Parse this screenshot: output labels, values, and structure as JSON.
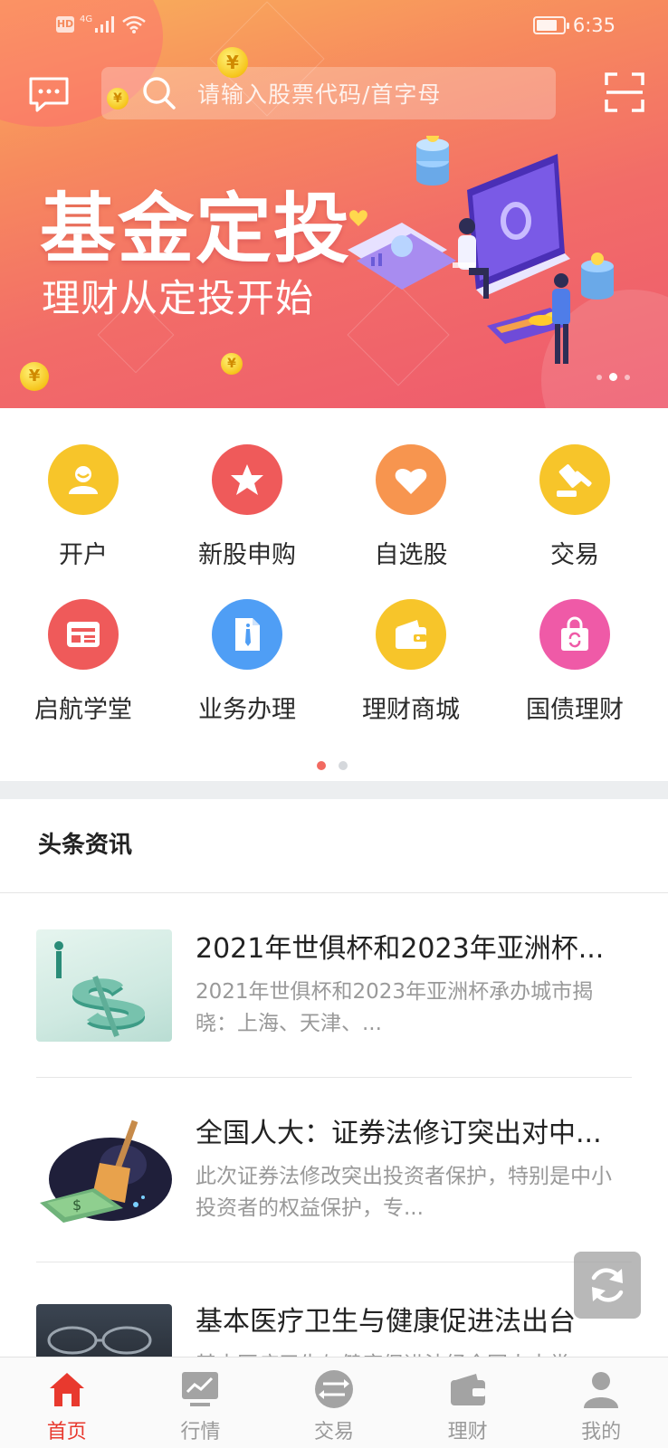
{
  "status_bar": {
    "hd": "HD",
    "network": "4G",
    "time": "6:35",
    "battery_level": 0.8
  },
  "search": {
    "placeholder": "请输入股票代码/首字母"
  },
  "banner": {
    "title": "基金定投",
    "subtitle": "理财从定投开始",
    "coin_glyph": "¥",
    "slides_count": 3,
    "active_slide": 2
  },
  "quick_actions": {
    "pages_count": 2,
    "active_page": 1,
    "items": [
      {
        "label": "开户",
        "icon": "user-icon",
        "color": "#f7c52a"
      },
      {
        "label": "新股申购",
        "icon": "star-icon",
        "color": "#ef5a5a"
      },
      {
        "label": "自选股",
        "icon": "heart-icon",
        "color": "#f7954f"
      },
      {
        "label": "交易",
        "icon": "gavel-icon",
        "color": "#f7c52a"
      },
      {
        "label": "启航学堂",
        "icon": "newspaper-icon",
        "color": "#ef5a5a"
      },
      {
        "label": "业务办理",
        "icon": "document-tie-icon",
        "color": "#4f9ef5"
      },
      {
        "label": "理财商城",
        "icon": "wallet-icon",
        "color": "#f7c52a"
      },
      {
        "label": "国债理财",
        "icon": "shopping-bag-icon",
        "color": "#ef5aa7"
      }
    ]
  },
  "news": {
    "title": "头条资讯",
    "items": [
      {
        "title": "2021年世俱杯和2023年亚洲杯...",
        "desc": "2021年世俱杯和2023年亚洲杯承办城市揭晓：上海、天津、..."
      },
      {
        "title": "全国人大：证券法修订突出对中...",
        "desc": "此次证券法修改突出投资者保护，特别是中小投资者的权益保护，专..."
      },
      {
        "title": "基本医疗卫生与健康促进法出台",
        "desc": "基本医疗卫生与健康促进法经全国人大常"
      }
    ]
  },
  "tabbar": {
    "active": 0,
    "items": [
      {
        "label": "首页",
        "icon": "home-icon"
      },
      {
        "label": "行情",
        "icon": "chart-icon"
      },
      {
        "label": "交易",
        "icon": "exchange-icon"
      },
      {
        "label": "理财",
        "icon": "wallet-icon"
      },
      {
        "label": "我的",
        "icon": "profile-icon"
      }
    ]
  },
  "colors": {
    "accent": "#e8392e",
    "banner_top": "#f9b25a",
    "banner_bottom": "#ee5a6e"
  }
}
